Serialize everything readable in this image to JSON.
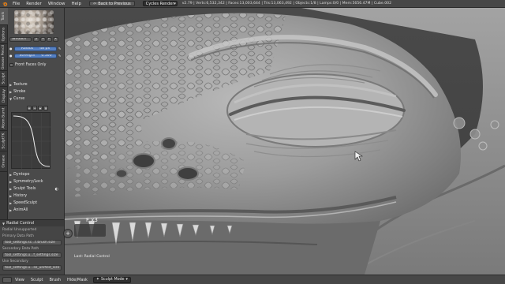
{
  "header": {
    "menus": [
      "File",
      "Render",
      "Window",
      "Help"
    ],
    "back_button": "Back to Previous",
    "render_engine": "Cycles Render",
    "stats": "v2.79 | Verts:6,532,342 | Faces:13,003,644 | Tris:13,063,492 | Objects:1/8 | Lamps:0/0 | Mem:5656.47M | Cube.002"
  },
  "tool_tabs": [
    "Tools",
    "Options",
    "Grease Pencil",
    "Sculpt",
    "Display",
    "Atom Burnt",
    "SculptTK",
    "Grease"
  ],
  "brush": {
    "name": "Smooth",
    "users": "2",
    "radius_label": "Radius",
    "radius_value": "48 px",
    "strength_label": "Strength",
    "strength_value": "0.500",
    "front_faces": "Front Faces Only"
  },
  "panels": [
    "Texture",
    "Stroke",
    "Curve"
  ],
  "panels_lower": [
    "Dyntopo",
    "Symmetry/Lock",
    "Sculpt Tools",
    "History",
    "SpeedSculpt",
    "AnimAll"
  ],
  "radial_control": {
    "title": "Radial Control",
    "rows": [
      "Radial Unsupported",
      "Primary Data Path",
      "tool_settings.sc...t.brush.size",
      "Secondary Data Path",
      "tool_settings.u...f_settings.size",
      "Use Secondary",
      "tool_settings.u...se_unified_size"
    ]
  },
  "viewport": {
    "key_hint": "F x3",
    "last_operator": "Last: Radial Control"
  },
  "footer": {
    "menus": [
      "View",
      "Sculpt",
      "Brush",
      "Hide/Mask"
    ],
    "mode": "Sculpt Mode"
  }
}
